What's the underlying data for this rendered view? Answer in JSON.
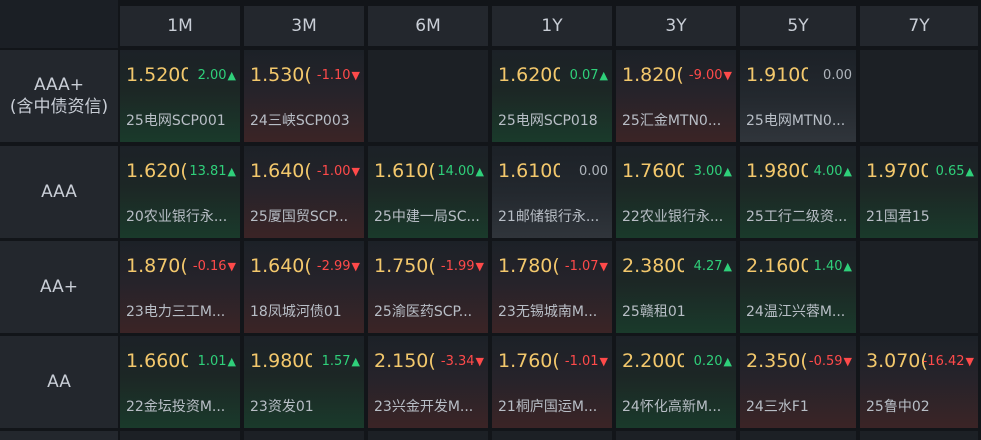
{
  "columns": [
    "1M",
    "3M",
    "6M",
    "1Y",
    "3Y",
    "5Y",
    "7Y"
  ],
  "rows": [
    {
      "label": "AAA+",
      "sublabel": "(含中债资信)",
      "cells": [
        {
          "rate": "1.5200",
          "change": "2.00",
          "dir": "up",
          "name": "25电网SCP001"
        },
        {
          "rate": "1.530(",
          "change": "-1.10",
          "dir": "down",
          "name": "24三峡SCP003"
        },
        null,
        {
          "rate": "1.6200",
          "change": "0.07",
          "dir": "up",
          "name": "25电网SCP018"
        },
        {
          "rate": "1.820(",
          "change": "-9.00",
          "dir": "down",
          "name": "25汇金MTN0..."
        },
        {
          "rate": "1.9100",
          "change": "0.00",
          "dir": "flat",
          "name": "25电网MTN0..."
        },
        null
      ]
    },
    {
      "label": "AAA",
      "sublabel": "",
      "cells": [
        {
          "rate": "1.620(",
          "change": "13.81",
          "dir": "up",
          "name": "20农业银行永..."
        },
        {
          "rate": "1.640(",
          "change": "-1.00",
          "dir": "down",
          "name": "25厦国贸SCP..."
        },
        {
          "rate": "1.610(",
          "change": "14.00",
          "dir": "up",
          "name": "25中建一局SC..."
        },
        {
          "rate": "1.6100",
          "change": "0.00",
          "dir": "flat",
          "name": "21邮储银行永..."
        },
        {
          "rate": "1.7600",
          "change": "3.00",
          "dir": "up",
          "name": "22农业银行永..."
        },
        {
          "rate": "1.9800",
          "change": "4.00",
          "dir": "up",
          "name": "25工行二级资..."
        },
        {
          "rate": "1.9700",
          "change": "0.65",
          "dir": "up",
          "name": "21国君15"
        }
      ]
    },
    {
      "label": "AA+",
      "sublabel": "",
      "cells": [
        {
          "rate": "1.870(",
          "change": "-0.16",
          "dir": "down",
          "name": "23电力三工M..."
        },
        {
          "rate": "1.640(",
          "change": "-2.99",
          "dir": "down",
          "name": "18凤城河债01"
        },
        {
          "rate": "1.750(",
          "change": "-1.99",
          "dir": "down",
          "name": "25渝医药SCP..."
        },
        {
          "rate": "1.780(",
          "change": "-1.07",
          "dir": "down",
          "name": "23无锡城南M..."
        },
        {
          "rate": "2.3800",
          "change": "4.27",
          "dir": "up",
          "name": "25赣租01"
        },
        {
          "rate": "2.1600",
          "change": "1.40",
          "dir": "up",
          "name": "24温江兴蓉M..."
        },
        null
      ]
    },
    {
      "label": "AA",
      "sublabel": "",
      "cells": [
        {
          "rate": "1.6600",
          "change": "1.01",
          "dir": "up",
          "name": "22金坛投资M..."
        },
        {
          "rate": "1.9800",
          "change": "1.57",
          "dir": "up",
          "name": "23资发01"
        },
        {
          "rate": "2.150(",
          "change": "-3.34",
          "dir": "down",
          "name": "23兴金开发M..."
        },
        {
          "rate": "1.760(",
          "change": "-1.01",
          "dir": "down",
          "name": "21桐庐国运M..."
        },
        {
          "rate": "2.2000",
          "change": "0.20",
          "dir": "up",
          "name": "24怀化高新M..."
        },
        {
          "rate": "2.350(",
          "change": "-0.59",
          "dir": "down",
          "name": "24三水F1"
        },
        {
          "rate": "3.070(",
          "change": "-16.42",
          "dir": "down",
          "name": "25鲁中02"
        }
      ]
    }
  ],
  "arrows": {
    "up": "▲",
    "down": "▼",
    "flat": ""
  },
  "colors": {
    "rate": "#f3c86c",
    "up": "#2fd07a",
    "down": "#ff4a4a",
    "flat": "#aeb4bb"
  }
}
